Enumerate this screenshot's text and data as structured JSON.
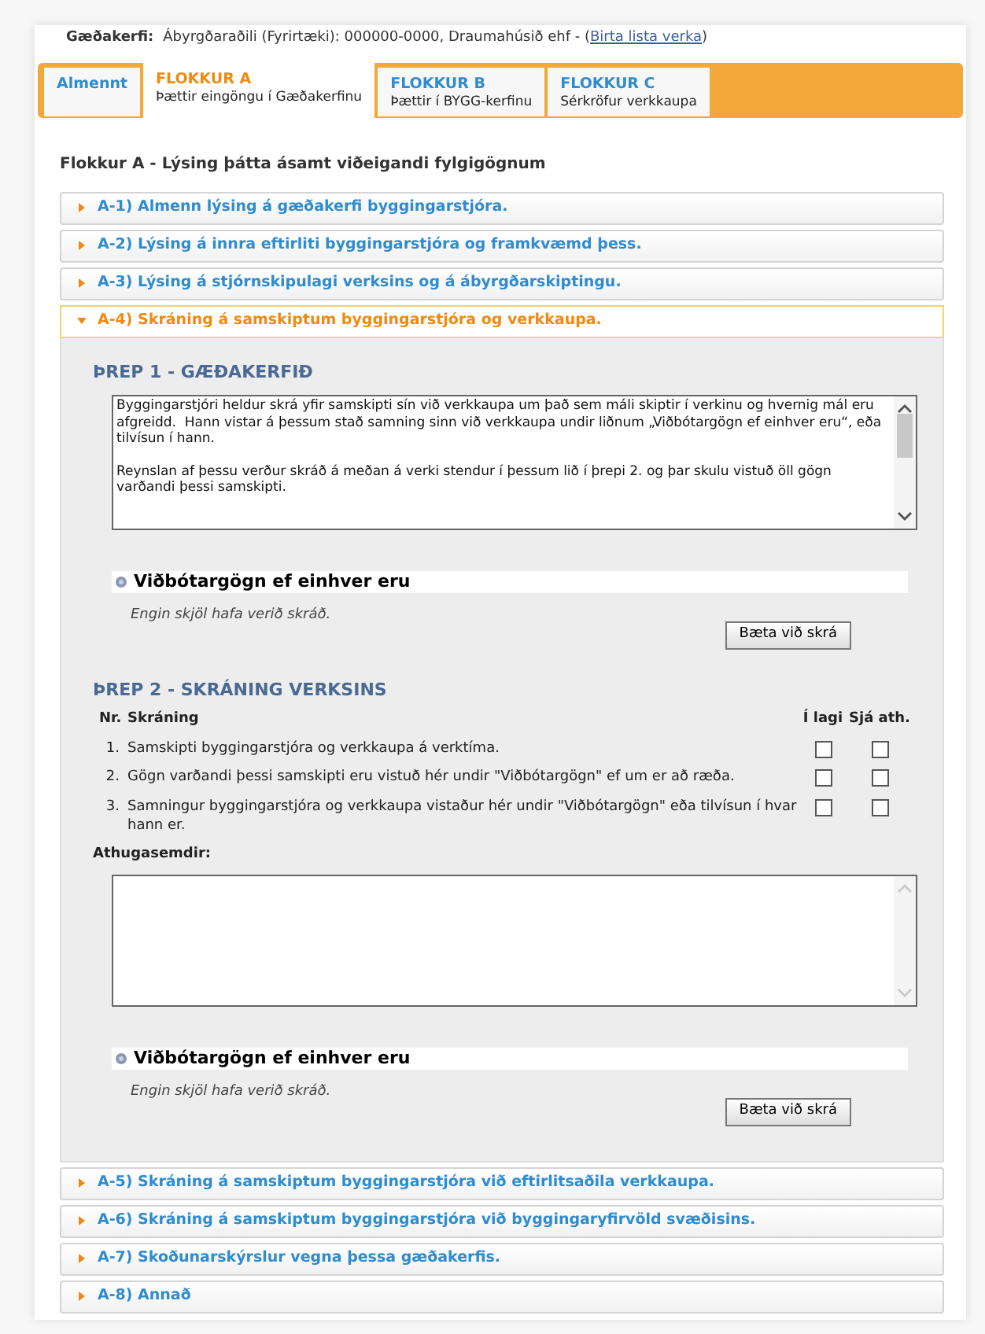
{
  "header": {
    "label": "Gæðakerfi:",
    "text": "Ábyrgðaraðili (Fyrirtæki): 000000-0000, Draumahúsið ehf - (",
    "link": "Birta lista verka",
    "suffix": ")"
  },
  "tabs": [
    {
      "title": "Almennt",
      "selected": false
    },
    {
      "title": "FLOKKUR A",
      "subtitle": "Þættir eingöngu í Gæðakerfinu",
      "selected": true
    },
    {
      "title": "FLOKKUR B",
      "subtitle": "Þættir í BYGG-kerfinu",
      "selected": false
    },
    {
      "title": "FLOKKUR C",
      "subtitle": "Sérkröfur verkkaupa",
      "selected": false
    }
  ],
  "heading": "Flokkur A - Lýsing þátta ásamt viðeigandi fylgigögnum",
  "sections": [
    {
      "label": "A-1) Almenn lýsing á gæðakerfi byggingarstjóra.",
      "expanded": false
    },
    {
      "label": "A-2) Lýsing á innra eftirliti byggingarstjóra og framkvæmd þess.",
      "expanded": false
    },
    {
      "label": "A-3) Lýsing á stjórnskipulagi verksins og á ábyrgðarskiptingu.",
      "expanded": false
    },
    {
      "label": "A-4) Skráning á samskiptum byggingarstjóra og verkkaupa.",
      "expanded": true,
      "content": {
        "step1": {
          "title": "ÞREP 1 - GÆÐAKERFIÐ",
          "paragraphs": [
            "Byggingarstjóri heldur skrá yfir samskipti sín við verkkaupa um það sem máli skiptir í verkinu og hvernig mál eru afgreidd.  Hann vistar á þessum stað samning sinn við verkkaupa undir liðnum „Viðbótargögn ef einhver eru“, eða tilvísun í hann.",
            "Reynslan af þessu verður skráð á meðan á verki stendur í þessum lið í þrepi 2. og þar skulu vistuð öll gögn varðandi þessi samskipti."
          ],
          "attachments": {
            "title": "Viðbótargögn ef einhver eru",
            "empty_text": "Engin skjöl hafa verið skráð.",
            "button": "Bæta við skrá"
          }
        },
        "step2": {
          "title": "ÞREP 2 - SKRÁNING VERKSINS",
          "columns": [
            "Nr.",
            "Skráning",
            "Í lagi",
            "Sjá ath."
          ],
          "rows": [
            {
              "nr": "1.",
              "text": "Samskipti byggingarstjóra og verkkaupa á verktíma.",
              "ok": false,
              "see_note": false
            },
            {
              "nr": "2.",
              "text": "Gögn varðandi þessi samskipti eru vistuð hér undir \"Viðbótargögn\" ef um er að ræða.",
              "ok": false,
              "see_note": false
            },
            {
              "nr": "3.",
              "text": "Samningur byggingarstjóra og verkkaupa vistaður hér undir \"Viðbótargögn\" eða tilvísun í hvar hann er.",
              "ok": false,
              "see_note": false
            }
          ],
          "comments_label": "Athugasemdir:",
          "attachments": {
            "title": "Viðbótargögn ef einhver eru",
            "empty_text": "Engin skjöl hafa verið skráð.",
            "button": "Bæta við skrá"
          }
        }
      }
    },
    {
      "label": "A-5) Skráning á samskiptum byggingarstjóra við eftirlitsaðila verkkaupa.",
      "expanded": false
    },
    {
      "label": "A-6) Skráning á samskiptum byggingarstjóra við byggingaryfirvöld svæðisins.",
      "expanded": false
    },
    {
      "label": "A-7) Skoðunarskýrslur vegna þessa gæðakerfis.",
      "expanded": false
    },
    {
      "label": "A-8) Annað",
      "expanded": false
    }
  ]
}
